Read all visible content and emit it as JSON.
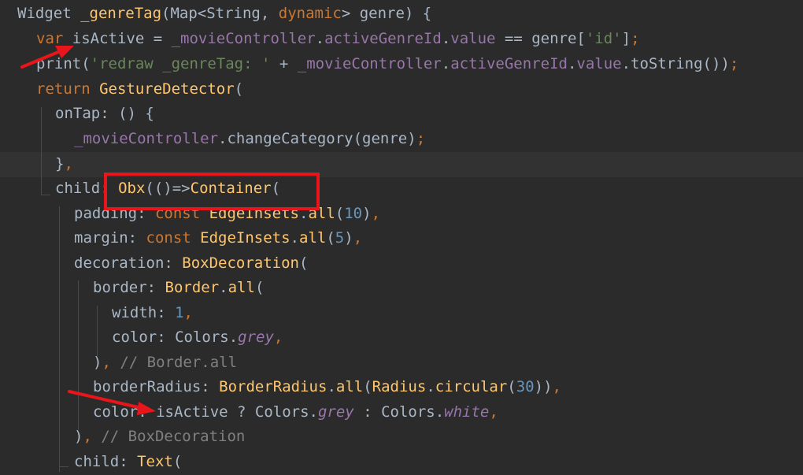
{
  "editor": {
    "lines": [
      [
        {
          "t": "Widget ",
          "c": "pl"
        },
        {
          "t": "_genreTag",
          "c": "fn"
        },
        {
          "t": "(Map<String, ",
          "c": "pl"
        },
        {
          "t": "dynamic",
          "c": "kw"
        },
        {
          "t": "> genre) {",
          "c": "pl"
        }
      ],
      [
        {
          "t": "var ",
          "c": "kw"
        },
        {
          "t": "isActive = ",
          "c": "pl"
        },
        {
          "t": "_movieController",
          "c": "fld"
        },
        {
          "t": ".",
          "c": "pl"
        },
        {
          "t": "activeGenreId",
          "c": "fld"
        },
        {
          "t": ".",
          "c": "pl"
        },
        {
          "t": "value",
          "c": "fld"
        },
        {
          "t": " == genre[",
          "c": "pl"
        },
        {
          "t": "'id'",
          "c": "str"
        },
        {
          "t": "]",
          "c": "pl"
        },
        {
          "t": ";",
          "c": "kw"
        }
      ],
      [
        {
          "t": "print(",
          "c": "pl"
        },
        {
          "t": "'redraw _genreTag: '",
          "c": "str"
        },
        {
          "t": " + ",
          "c": "pl"
        },
        {
          "t": "_movieController",
          "c": "fld"
        },
        {
          "t": ".",
          "c": "pl"
        },
        {
          "t": "activeGenreId",
          "c": "fld"
        },
        {
          "t": ".",
          "c": "pl"
        },
        {
          "t": "value",
          "c": "fld"
        },
        {
          "t": ".toString())",
          "c": "pl"
        },
        {
          "t": ";",
          "c": "kw"
        }
      ],
      [
        {
          "t": "return ",
          "c": "kw"
        },
        {
          "t": "GestureDetector",
          "c": "fn"
        },
        {
          "t": "(",
          "c": "pl"
        }
      ],
      [
        {
          "t": "onTap: () {",
          "c": "pl"
        }
      ],
      [
        {
          "t": "_movieController",
          "c": "fld"
        },
        {
          "t": ".changeCategory(genre)",
          "c": "pl"
        },
        {
          "t": ";",
          "c": "kw"
        }
      ],
      [
        {
          "t": "}",
          "c": "pl"
        },
        {
          "t": ",",
          "c": "kw"
        }
      ],
      [
        {
          "t": "child",
          "c": "pl"
        },
        {
          "t": ": ",
          "c": "pl"
        },
        {
          "t": "Obx",
          "c": "fn"
        },
        {
          "t": "(()=>",
          "c": "pl"
        },
        {
          "t": "Container",
          "c": "fn"
        },
        {
          "t": "(",
          "c": "pl"
        }
      ],
      [
        {
          "t": "padding: ",
          "c": "pl"
        },
        {
          "t": "const ",
          "c": "kw"
        },
        {
          "t": "EdgeInsets",
          "c": "fn"
        },
        {
          "t": ".",
          "c": "pl"
        },
        {
          "t": "all",
          "c": "fn"
        },
        {
          "t": "(",
          "c": "pl"
        },
        {
          "t": "10",
          "c": "num"
        },
        {
          "t": ")",
          "c": "pl"
        },
        {
          "t": ",",
          "c": "kw"
        }
      ],
      [
        {
          "t": "margin: ",
          "c": "pl"
        },
        {
          "t": "const ",
          "c": "kw"
        },
        {
          "t": "EdgeInsets",
          "c": "fn"
        },
        {
          "t": ".",
          "c": "pl"
        },
        {
          "t": "all",
          "c": "fn"
        },
        {
          "t": "(",
          "c": "pl"
        },
        {
          "t": "5",
          "c": "num"
        },
        {
          "t": ")",
          "c": "pl"
        },
        {
          "t": ",",
          "c": "kw"
        }
      ],
      [
        {
          "t": "decoration: ",
          "c": "pl"
        },
        {
          "t": "BoxDecoration",
          "c": "fn"
        },
        {
          "t": "(",
          "c": "pl"
        }
      ],
      [
        {
          "t": "border: ",
          "c": "pl"
        },
        {
          "t": "Border",
          "c": "fn"
        },
        {
          "t": ".",
          "c": "pl"
        },
        {
          "t": "all",
          "c": "fn"
        },
        {
          "t": "(",
          "c": "pl"
        }
      ],
      [
        {
          "t": "width: ",
          "c": "pl"
        },
        {
          "t": "1",
          "c": "num"
        },
        {
          "t": ",",
          "c": "kw"
        }
      ],
      [
        {
          "t": "color: Colors.",
          "c": "pl"
        },
        {
          "t": "grey",
          "c": "ita"
        },
        {
          "t": ",",
          "c": "kw"
        }
      ],
      [
        {
          "t": ")",
          "c": "pl"
        },
        {
          "t": ", ",
          "c": "kw"
        },
        {
          "t": "// Border.all",
          "c": "cmt"
        }
      ],
      [
        {
          "t": "borderRadius: ",
          "c": "pl"
        },
        {
          "t": "BorderRadius",
          "c": "fn"
        },
        {
          "t": ".",
          "c": "pl"
        },
        {
          "t": "all",
          "c": "fn"
        },
        {
          "t": "(",
          "c": "pl"
        },
        {
          "t": "Radius",
          "c": "fn"
        },
        {
          "t": ".",
          "c": "pl"
        },
        {
          "t": "circular",
          "c": "fn"
        },
        {
          "t": "(",
          "c": "pl"
        },
        {
          "t": "30",
          "c": "num"
        },
        {
          "t": "))",
          "c": "pl"
        },
        {
          "t": ",",
          "c": "kw"
        }
      ],
      [
        {
          "t": "color: isActive ? Colors.",
          "c": "pl"
        },
        {
          "t": "grey",
          "c": "ita"
        },
        {
          "t": " : Colors.",
          "c": "pl"
        },
        {
          "t": "white",
          "c": "ita"
        },
        {
          "t": ",",
          "c": "kw"
        }
      ],
      [
        {
          "t": ")",
          "c": "pl"
        },
        {
          "t": ", ",
          "c": "kw"
        },
        {
          "t": "// BoxDecoration",
          "c": "cmt"
        }
      ],
      [
        {
          "t": "child",
          "c": "pl"
        },
        {
          "t": ": ",
          "c": "pl"
        },
        {
          "t": "Text",
          "c": "fn"
        },
        {
          "t": "(",
          "c": "pl"
        }
      ]
    ]
  },
  "colors": {
    "background": "#2b2b2b",
    "keyword": "#cc7832",
    "function": "#ffc66d",
    "string": "#6a8759",
    "number": "#6897bb",
    "field": "#9876aa",
    "comment": "#808080",
    "annotation": "#e8161a"
  }
}
